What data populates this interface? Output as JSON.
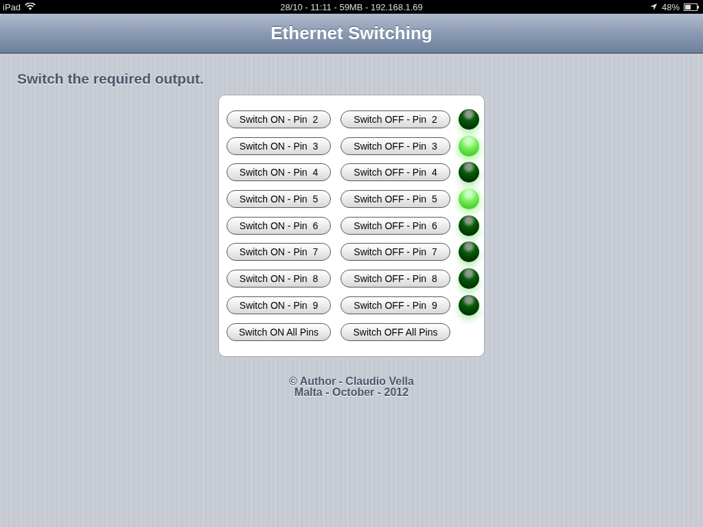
{
  "status_bar": {
    "device": "iPad",
    "center": "28/10 - 11:11 - 59MB - 192.168.1.69",
    "battery": "48%"
  },
  "title": "Ethernet Switching",
  "instruction": "Switch the required output.",
  "pins": [
    {
      "on_button": "Switch ON - Pin  2",
      "off_button": "Switch OFF - Pin  2",
      "on": false
    },
    {
      "on_button": "Switch ON - Pin  3",
      "off_button": "Switch OFF - Pin  3",
      "on": true
    },
    {
      "on_button": "Switch ON - Pin  4",
      "off_button": "Switch OFF - Pin  4",
      "on": false
    },
    {
      "on_button": "Switch ON - Pin  5",
      "off_button": "Switch OFF - Pin  5",
      "on": true
    },
    {
      "on_button": "Switch ON - Pin  6",
      "off_button": "Switch OFF - Pin  6",
      "on": false
    },
    {
      "on_button": "Switch ON - Pin  7",
      "off_button": "Switch OFF - Pin  7",
      "on": false
    },
    {
      "on_button": "Switch ON - Pin  8",
      "off_button": "Switch OFF - Pin  8",
      "on": false
    },
    {
      "on_button": "Switch ON - Pin  9",
      "off_button": "Switch OFF - Pin  9",
      "on": false
    }
  ],
  "all_buttons": {
    "on": "Switch ON All Pins",
    "off": "Switch OFF All Pins"
  },
  "footer": [
    "© Author - Claudio Vella",
    "Malta - October - 2012"
  ]
}
